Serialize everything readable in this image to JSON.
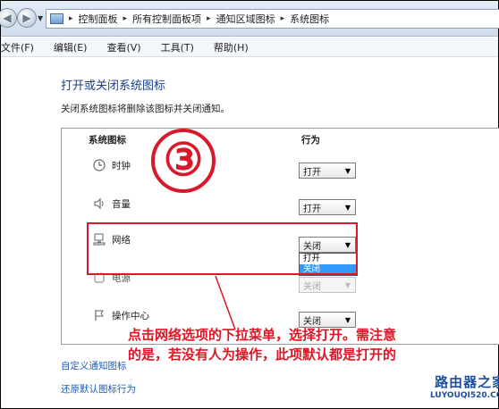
{
  "address_bar": {
    "crumbs": [
      "控制面板",
      "所有控制面板项",
      "通知区域图标",
      "系统图标"
    ]
  },
  "menu": {
    "file": "文件(F)",
    "edit": "编辑(E)",
    "view": "查看(V)",
    "tools": "工具(T)",
    "help": "帮助(H)"
  },
  "page": {
    "title": "打开或关闭系统图标",
    "subtitle": "关闭系统图标将删除该图标并关闭通知。"
  },
  "table": {
    "col_icon": "系统图标",
    "col_behavior": "行为",
    "rows": [
      {
        "label": "时钟",
        "icon": "clock-icon",
        "value": "打开",
        "enabled": true
      },
      {
        "label": "音量",
        "icon": "volume-icon",
        "value": "打开",
        "enabled": true
      },
      {
        "label": "网络",
        "icon": "network-icon",
        "value": "关闭",
        "enabled": true
      },
      {
        "label": "电源",
        "icon": "power-icon",
        "value": "关闭",
        "enabled": false
      },
      {
        "label": "操作中心",
        "icon": "action-center-flag-icon",
        "value": "关闭",
        "enabled": true
      }
    ]
  },
  "dropdown_open": {
    "options": [
      "打开",
      "关闭"
    ],
    "highlighted": "关闭"
  },
  "annotation": {
    "step_marker": "③",
    "text_line1": "点击网络选项的下拉菜单，选择打开。需注意",
    "text_line2": "的是，若没有人为操作，此项默认都是打开的"
  },
  "links": {
    "customize": "自定义通知图标",
    "restore": "还原默认图标行为"
  },
  "watermark": {
    "name": "路由器之家",
    "url": "LUYOUQI520.COM"
  },
  "colors": {
    "annotation_red": "#d8192a",
    "link_blue": "#1c5bb5",
    "title_blue": "#1a3e8c"
  }
}
